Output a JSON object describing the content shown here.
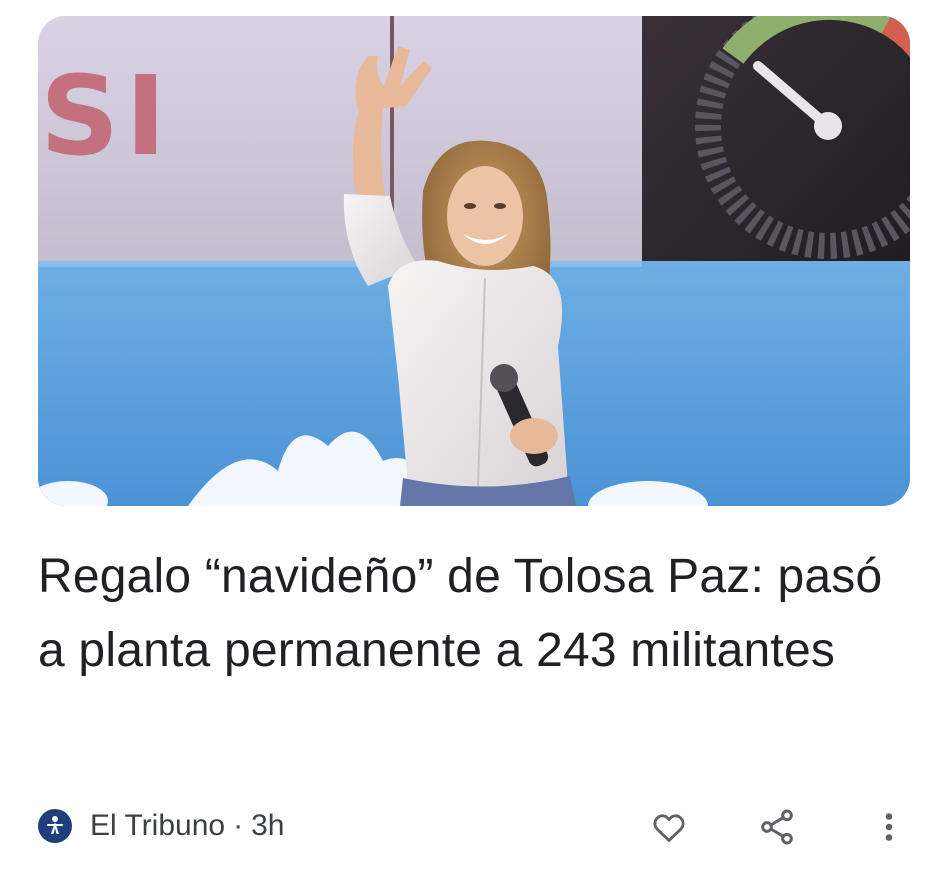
{
  "article": {
    "headline": "Regalo “navideño” de Tolosa Paz: pasó a planta permanente a 243 militantes",
    "source": "El Tribuno",
    "separator": "·",
    "age": "3h",
    "image_sign_text": "SI"
  },
  "icons": {
    "source_logo": "el-tribuno-logo",
    "like": "heart-outline-icon",
    "share": "share-icon",
    "more": "more-vert-icon"
  },
  "colors": {
    "headline": "#202124",
    "meta": "#3c4043",
    "icon": "#5f6368",
    "logo_bg": "#1f3f7a"
  }
}
